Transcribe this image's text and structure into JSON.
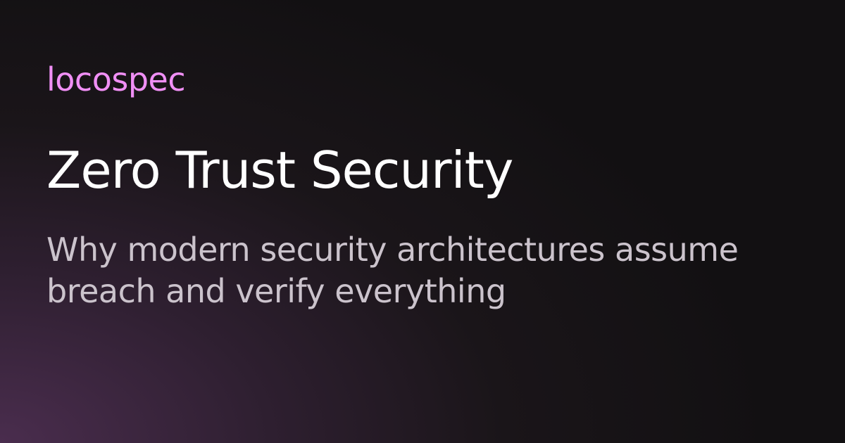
{
  "brand": {
    "name": "locospec",
    "color": "#f08ff5"
  },
  "hero": {
    "title": "Zero Trust Security",
    "subtitle": "Why modern security architectures assume breach and verify everything"
  },
  "colors": {
    "title": "#ffffff",
    "subtitle": "#cbc3cc",
    "background_dark": "#121012",
    "background_glow": "#4a2d4e"
  }
}
